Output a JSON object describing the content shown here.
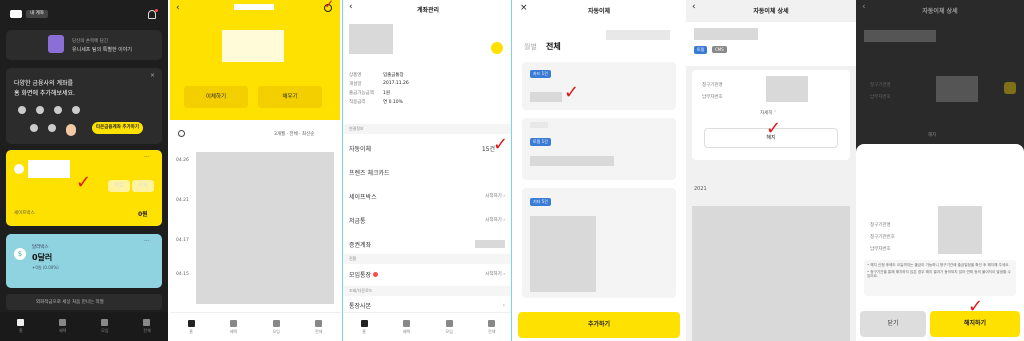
{
  "p1": {
    "badge": "내 계좌",
    "banner_line1": "당신의 손목에 담긴",
    "banner_line2": "유니세프 팀의 특별한 이야기",
    "add_line1": "다양한 금융사의 계좌를",
    "add_line2": "홈 화면에 추가해보세요.",
    "add_btn": "타은금융계좌 추가하기",
    "card_btn1": "카드",
    "card_btn2": "이체",
    "safe_box": "세이프박스",
    "safe_amount": "0원",
    "dollar_title": "달러박스",
    "dollar_amount": "0달러",
    "dollar_rate": "+0원 (0.00%)",
    "bottom_note": "외화적금으로 세상 처음 만나는 적절",
    "nav": [
      "홈",
      "혜택",
      "모임",
      "전체"
    ]
  },
  "p2": {
    "btn_transfer": "이체하기",
    "btn_fill": "채우기",
    "filter": "3개월 · 전체 · 최신순",
    "dates": [
      "04.26",
      "04.21",
      "04.17",
      "04.15"
    ],
    "nav": [
      "홈",
      "혜택",
      "모임",
      "전체"
    ]
  },
  "p3": {
    "title": "계좌관리",
    "info": [
      {
        "k": "상품명",
        "v": "입출금통장"
      },
      {
        "k": "개설일",
        "v": "2017.11.26"
      },
      {
        "k": "출금가능금액",
        "v": "1원"
      },
      {
        "k": "적용금리",
        "v": "연 0.10%"
      }
    ],
    "sec1": "연결정보",
    "rows": [
      {
        "label": "자동이체",
        "value": "15건"
      },
      {
        "label": "프렌즈 체크카드",
        "value": ""
      },
      {
        "label": "세이프박스",
        "value": "시작하기"
      },
      {
        "label": "저금통",
        "value": "시작하기"
      },
      {
        "label": "증권계좌",
        "value": ""
      }
    ],
    "sec2": "전환",
    "meeting": "모임통장",
    "meeting_value": "시작하기",
    "sec3": "조회/다운로드",
    "statement": "통장사본",
    "nav": [
      "홈",
      "혜택",
      "모임",
      "전체"
    ]
  },
  "p4": {
    "title": "자동이체",
    "tab_month": "월별",
    "tab_all": "전체",
    "tags": [
      "카드 1건",
      "토핑 1건",
      "기타 5건"
    ],
    "add_btn": "추가하기"
  },
  "p5": {
    "title": "자동이체 상세",
    "tags": [
      "토핑",
      "CMS"
    ],
    "f1": "청구기관명",
    "f2": "납부자번호",
    "more": "자세히",
    "cancel": "해지",
    "year": "2021"
  },
  "p6": {
    "title": "자동이체 상세",
    "f1": "청구기관명",
    "f2": "납부자번호",
    "cancel_small": "해지",
    "sheet_f1": "청구기관명",
    "sheet_f2": "청구기관번호",
    "sheet_f3": "납부자번호",
    "note1": "• 해지 신청 후에도 오늘까지는 출금이 가능하니 청구기관에 출금일정을 확인 후 해지해 주세요.",
    "note2": "• 청구기관을 통해 해지하지 않은 경우 해지 결과가 동의되지 않아 연체 등의 불이익이 발생할 수 있어요.",
    "btn_close": "닫기",
    "btn_cancel": "해지하기"
  }
}
